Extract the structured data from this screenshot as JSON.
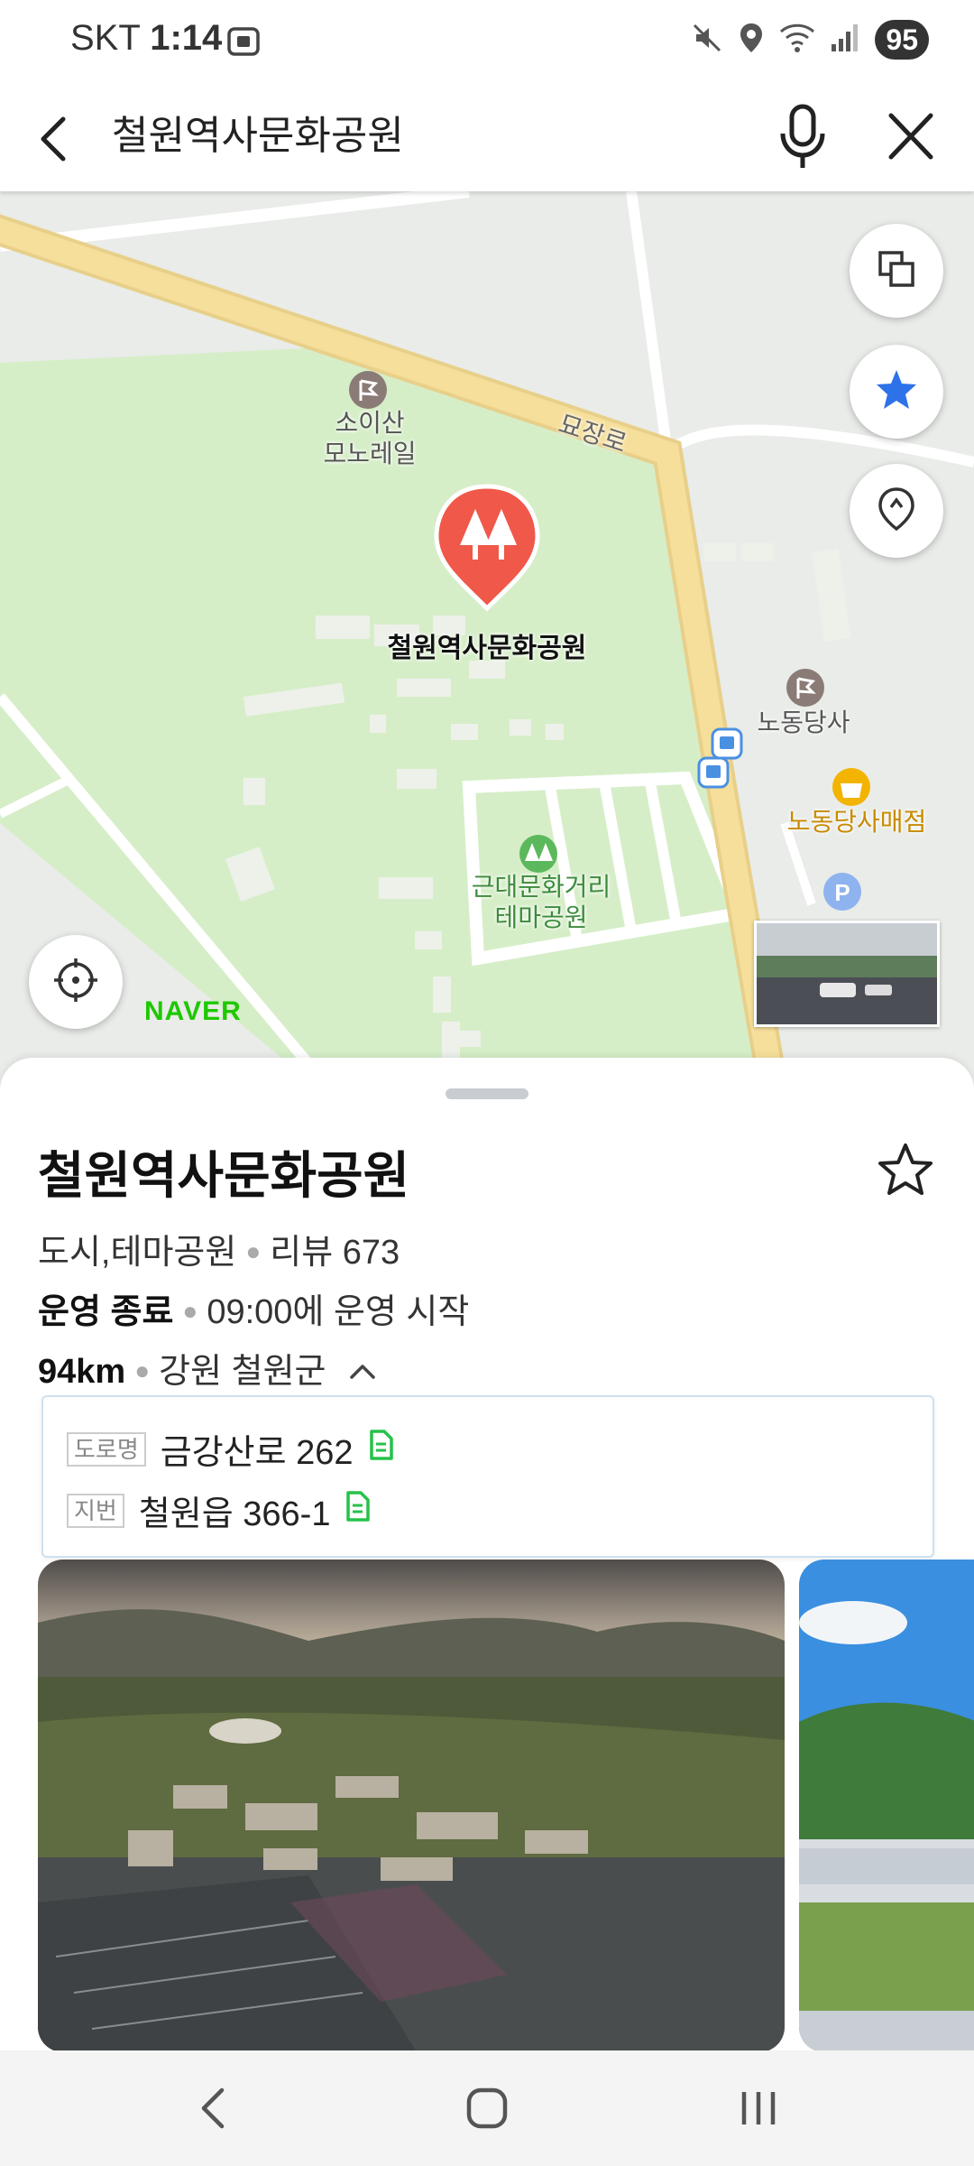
{
  "status_bar": {
    "carrier": "SKT",
    "time": "1:14",
    "battery": "95",
    "icons": [
      "screenshot-icon",
      "mute-icon",
      "location-icon",
      "wifi-icon",
      "signal-icon"
    ]
  },
  "search": {
    "query": "철원역사문화공원",
    "icons": [
      "back-icon",
      "mic-icon",
      "close-icon"
    ]
  },
  "map": {
    "labels": {
      "monorail": "소이산\n모노레일",
      "road": "묘장로",
      "park": "철원역사문화공원",
      "labor_party": "노동당사",
      "store": "노동당사매점",
      "theme_park": "근대문화거리\n테마공원"
    },
    "brand": "NAVER",
    "colors": {
      "park_green": "#d6eec8",
      "road_yellow": "#f6df9a",
      "pin_red": "#f0584a",
      "star_blue": "#2d72e8"
    }
  },
  "place": {
    "name": "철원역사문화공원",
    "category": "도시,테마공원",
    "review": "리뷰 673",
    "status": "운영 종료",
    "hours": "09:00에 운영 시작",
    "distance": "94km",
    "region": "강원 철원군",
    "address": {
      "road_tag": "도로명",
      "road": "금강산로 262",
      "lot_tag": "지번",
      "lot": "철원읍 366-1"
    }
  }
}
